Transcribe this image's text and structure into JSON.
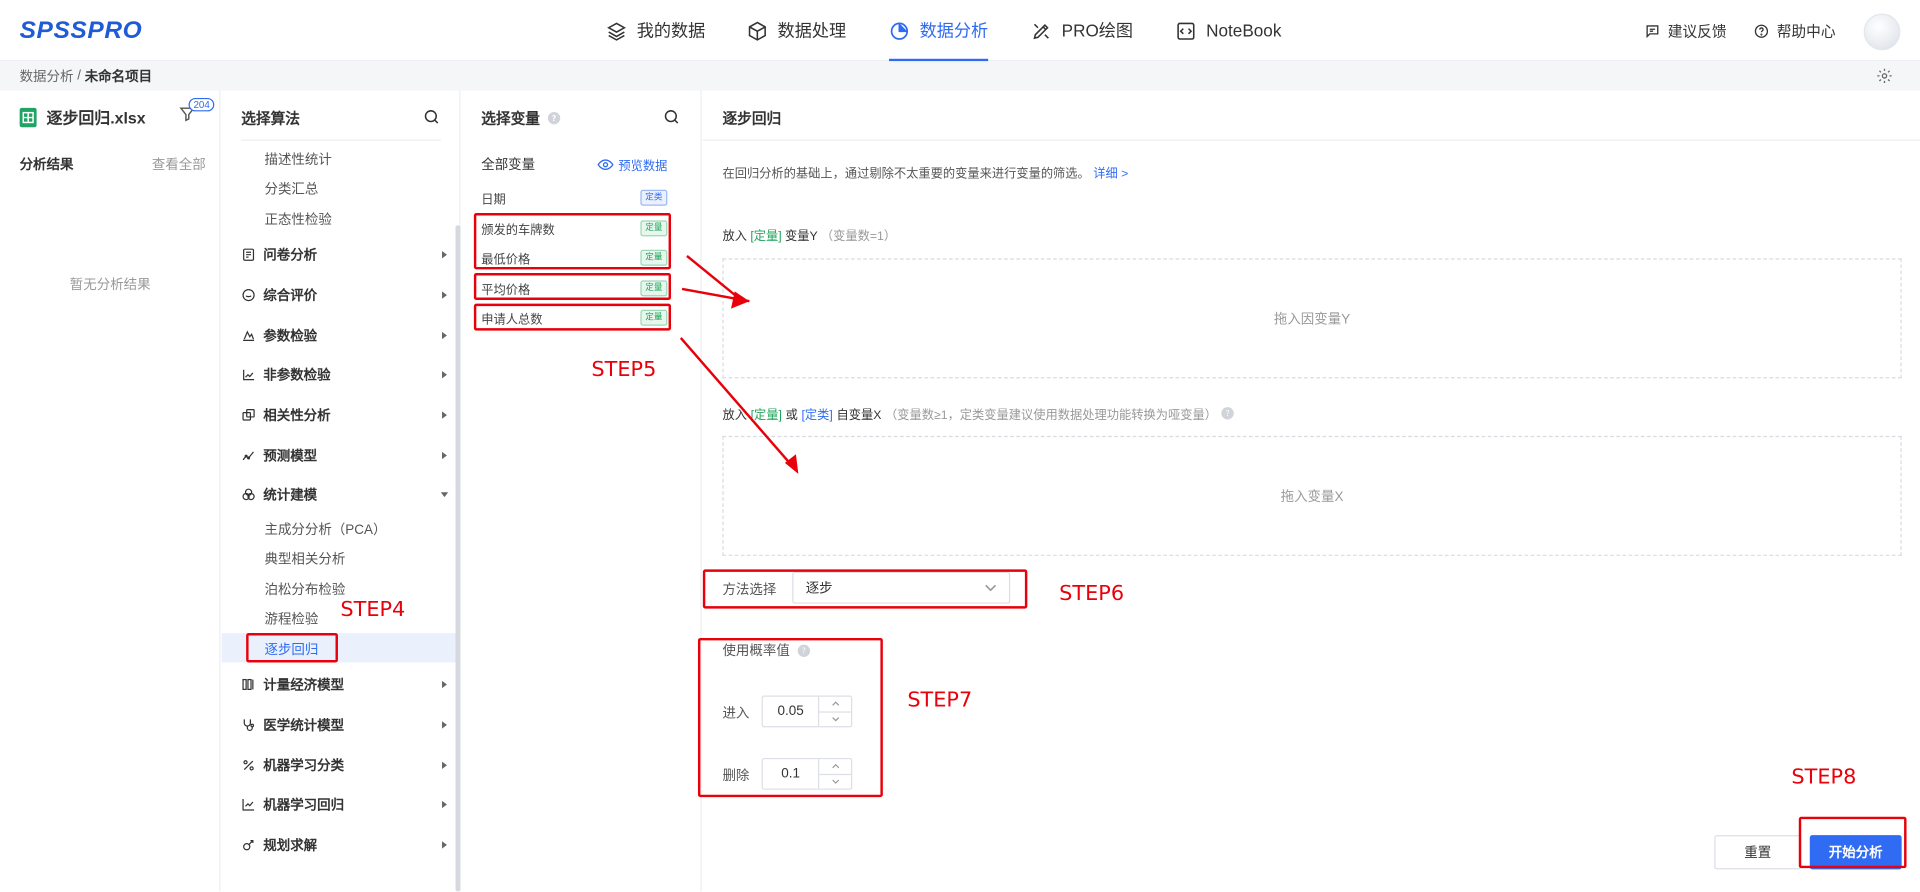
{
  "app": {
    "logo": "SPSSPRO"
  },
  "nav": {
    "items": [
      {
        "label": "我的数据",
        "icon": "layers-icon"
      },
      {
        "label": "数据处理",
        "icon": "cube-icon"
      },
      {
        "label": "数据分析",
        "icon": "pie-chart-icon",
        "active": true
      },
      {
        "label": "PRO绘图",
        "icon": "pen-tool-icon"
      },
      {
        "label": "NoteBook",
        "icon": "code-icon"
      }
    ],
    "feedback": "建议反馈",
    "help": "帮助中心"
  },
  "breadcrumb": {
    "root": "数据分析",
    "separator": " / ",
    "current": "未命名项目"
  },
  "left_panel": {
    "file_name": "逐步回归.xlsx",
    "filter_count": "204",
    "results_title": "分析结果",
    "see_all": "查看全部",
    "empty_text": "暂无分析结果"
  },
  "algo_panel": {
    "title": "选择算法",
    "top_subitems": [
      "描述性统计",
      "分类汇总",
      "正态性检验"
    ],
    "groups": [
      {
        "label": "问卷分析",
        "icon": "survey-icon"
      },
      {
        "label": "综合评价",
        "icon": "evaluation-icon"
      },
      {
        "label": "参数检验",
        "icon": "parametric-test-icon"
      },
      {
        "label": "非参数检验",
        "icon": "nonparametric-test-icon"
      },
      {
        "label": "相关性分析",
        "icon": "correlation-icon"
      },
      {
        "label": "预测模型",
        "icon": "prediction-icon"
      },
      {
        "label": "统计建模",
        "icon": "modeling-icon",
        "expanded": true
      }
    ],
    "modeling_subitems": [
      "主成分分析（PCA）",
      "典型相关分析",
      "泊松分布检验",
      "游程检验",
      "逐步回归"
    ],
    "active_subitem": "逐步回归",
    "groups_after": [
      {
        "label": "计量经济模型",
        "icon": "econometric-icon"
      },
      {
        "label": "医学统计模型",
        "icon": "stethoscope-icon"
      },
      {
        "label": "机器学习分类",
        "icon": "percent-icon"
      },
      {
        "label": "机器学习回归",
        "icon": "regression-chart-icon"
      },
      {
        "label": "规划求解",
        "icon": "planning-icon"
      }
    ]
  },
  "var_panel": {
    "title": "选择变量",
    "all_vars": "全部变量",
    "preview": "预览数据",
    "variables": [
      {
        "name": "日期",
        "type": "定类",
        "color": "#2f6bf3"
      },
      {
        "name": "颁发的车牌数",
        "type": "定量",
        "color": "#1ea35a"
      },
      {
        "name": "最低价格",
        "type": "定量",
        "color": "#1ea35a"
      },
      {
        "name": "平均价格",
        "type": "定量",
        "color": "#1ea35a"
      },
      {
        "name": "申请人总数",
        "type": "定量",
        "color": "#1ea35a"
      }
    ]
  },
  "config_panel": {
    "title": "逐步回归",
    "description": "在回归分析的基础上，通过剔除不太重要的变量来进行变量的筛选。",
    "detail_link": "详细 >",
    "y_label": {
      "prefix": "放入",
      "tag": "[定量]",
      "suffix": "变量Y",
      "hint": "（变量数=1）"
    },
    "y_drop": "拖入因变量Y",
    "x_label": {
      "prefix": "放入",
      "tag1": "[定量]",
      "or": "或",
      "tag2": "[定类]",
      "suffix": "自变量X",
      "hint": "（变量数≥1，定类变量建议使用数据处理功能转换为哑变量）"
    },
    "x_drop": "拖入变量X",
    "method_label": "方法选择",
    "method_value": "逐步",
    "prob_label": "使用概率值",
    "enter_label": "进入",
    "enter_value": "0.05",
    "remove_label": "删除",
    "remove_value": "0.1",
    "reset": "重置",
    "start": "开始分析"
  },
  "annotations": {
    "color": "#e8000b",
    "steps": [
      "STEP4",
      "STEP5",
      "STEP6",
      "STEP7",
      "STEP8"
    ]
  }
}
